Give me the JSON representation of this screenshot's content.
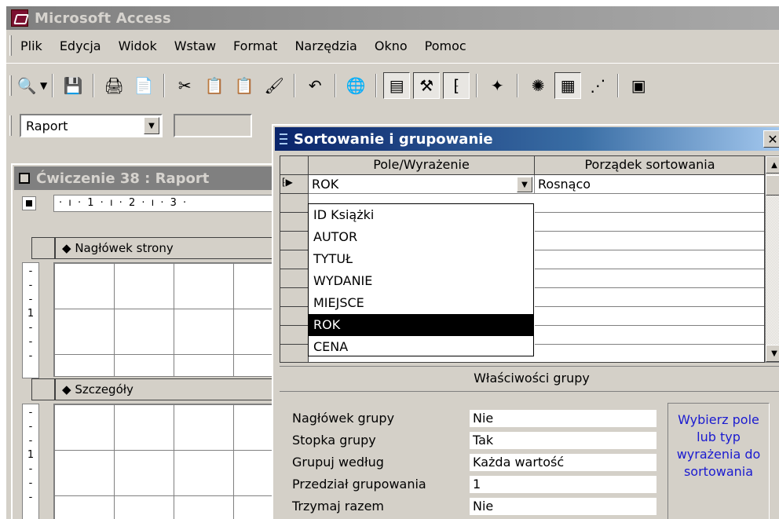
{
  "app": {
    "title": "Microsoft Access"
  },
  "menu": [
    "Plik",
    "Edycja",
    "Widok",
    "Wstaw",
    "Format",
    "Narzędzia",
    "Okno",
    "Pomoc"
  ],
  "format_bar": {
    "object_combo": "Raport"
  },
  "report_window": {
    "title": "Ćwiczenie 38 : Raport",
    "ruler_text": "· ı · 1 · ı · 2 · ı · 3 ·",
    "page_header": "Nagłówek strony",
    "detail": "Szczegóły",
    "vruler_marks": [
      "-",
      "-",
      "-",
      "1",
      "-",
      "-"
    ]
  },
  "dialog": {
    "title": "Sortowanie i grupowanie",
    "close": "✕",
    "headers": {
      "field": "Pole/Wyrażenie",
      "sort": "Porządek sortowania"
    },
    "first_row": {
      "field": "ROK",
      "sort": "Rosnąco"
    },
    "dropdown_items": [
      "ID Książki",
      "AUTOR",
      "TYTUŁ",
      "WYDANIE",
      "MIEJSCE",
      "ROK",
      "CENA"
    ],
    "dropdown_selected_index": 5,
    "group_props_title": "Właściwości grupy",
    "props": [
      {
        "label": "Nagłówek grupy",
        "value": "Nie"
      },
      {
        "label": "Stopka grupy",
        "value": "Tak"
      },
      {
        "label": "Grupuj według",
        "value": "Każda wartość"
      },
      {
        "label": "Przedział grupowania",
        "value": "1"
      },
      {
        "label": "Trzymaj razem",
        "value": "Nie"
      }
    ],
    "hint": "Wybierz pole lub typ wyrażenia do sortowania"
  },
  "colors": {
    "face": "#d4d0c8",
    "title_active": "#0a246a",
    "hint_text": "#1a1ad0"
  }
}
